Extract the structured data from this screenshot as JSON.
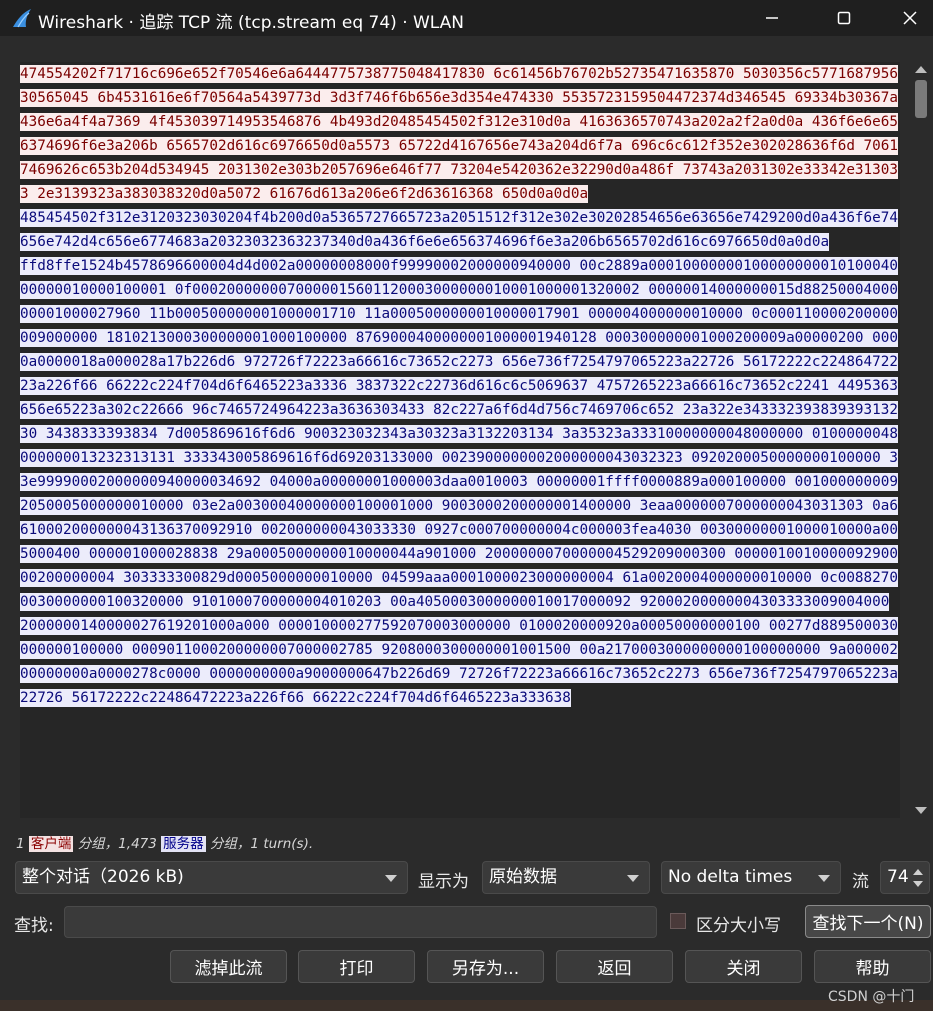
{
  "window": {
    "title": "Wireshark · 追踪 TCP 流 (tcp.stream eq 74) · WLAN",
    "minimize_glyph": "—",
    "maximize_glyph": "☐",
    "close_glyph": "✕",
    "icon": "wireshark-fin-icon"
  },
  "stream": {
    "chunks": [
      {
        "direction": "client",
        "text": "474554202f71716c696e652f70546e6a6444775738775048417830 6c61456b76702b52735471635870 5030356c577168795630565045 6b4531616e6f70564a5439773d 3d3f746f6b656e3d354e474330 5535723159504472374d346545 69334b30367a436e6a4f4a7369 4f453039714953546876 4b493d20485454502f312e310d0a 4163636570743a202a2f2a0d0a 436f6e6e656374696f6e3a206b 6565702d616c6976650d0a5573 65722d4167656e743a204d6f7a 696c6c612f352e302028636f6d 70617469626c653b204d534945 2031302e303b2057696e646f77 73204e5420362e32290d0a486f 73743a2031302e33342e313033 2e3139323a383038320d0a5072 61676d613a206e6f2d63616368 650d0a0d0a"
      },
      {
        "direction": "server",
        "text": "485454502f312e3120323030204f4b200d0a5365727665723a2051512f312e302e30202854656e63656e7429200d0a436f6e74656e742d4c656e6774683a20323032363237340d0a436f6e6e656374696f6e3a206b6565702d616c6976650d0a0d0a"
      },
      {
        "direction": "server",
        "text": "ffd8ffe1524b4578696600004d4d002a00000008000f99990002000000940000 00c2889a0001000000010000000001010004000000010000100001 0f0002000000070000015601120003000000010001000001320002 00000014000000015d8825000400000001000027960 11b000500000001000001710 11a0005000000010000017901 000004000000010000 0c000110000200000009000000 1810213000300000001000100000 8769000400000001000001940128 000300000001000200009a00000200 0000a0000018a000028a17b226d6 972726f72223a66616c73652c2273 656e736f7254797065223a22726 56172222c22486472223a226f66 66222c224f704d6f6465223a3336 3837322c22736d616c6c5069637 4757265223a66616c73652c2241 4495363656e65223a302c22666 96c7465724964223a3636303433 82c227a6f6d4d756c7469706c652 23a322e34333239383939313230 3438333393834 7d005869616f6d6 900323032343a30323a3132203134 3a35323a33310000000048000000 0100000048000000013232313131 333343005869616f6d69203133000 0023900000002000000043032323 0920200050000000100000 33e99990002000000940000034692 04000a00000001000003daa0010003 00000001ffff0000889a000100000 0010000000092050005000000010000 03e2a00300040000000100001000 9003000200000001400000 3eaa0000007000000043031303 0a6610002000000043136370092910 002000000043033330 0927c000700000004c000003fea4030 00300000001000010000a005000400 000001000028838 29a0005000000010000044a901000 2000000070000004529209000300 000001001000009290000200000004 303333300829d0005000000010000 04599aaa0001000023000000004 61a0020004000000010000 0c00882700030000000100320000 9101000700000004010203 00a4050003000000010017000092 92000200000004303333009004000 2000000140000027619201000a000 000010000277592070003000000 0100020000920a00050000000100 00277d889500030000000100000 0009011000200000007000002785 9208000300000001001500 00a2170003000000000100000000 9a00000200000000a0000278c0000 0000000000a9000000647b226d69 72726f72223a66616c73652c2273 656e736f7254797065223a22726 56172222c22486472223a226f66 66222c224f704d6f6465223a333638"
      }
    ]
  },
  "status": {
    "prefix": "1",
    "client_tag": "客户端",
    "middle": "分组，1,473",
    "server_tag": "服务器",
    "suffix": "分组，1 turn(s)."
  },
  "controls": {
    "conversation_select": "整个对话（2026 kB)",
    "show_as_label": "显示为",
    "show_as_select": "原始数据",
    "delta_select": "No delta times",
    "stream_label": "流",
    "stream_value": "74",
    "find_label": "查找:",
    "find_value": "",
    "case_sensitive_label": "区分大小写",
    "find_next_button": "查找下一个(N)"
  },
  "buttons": {
    "filter_out": "滤掉此流",
    "print": "打印",
    "save_as": "另存为...",
    "back": "返回",
    "close": "关闭",
    "help": "帮助"
  },
  "watermark": "CSDN @十门",
  "colors": {
    "client_fg": "#7a0000",
    "client_bg": "#fbeded",
    "server_fg": "#0a0a7a",
    "server_bg": "#ececfb",
    "window_bg": "#2b2b2b"
  }
}
